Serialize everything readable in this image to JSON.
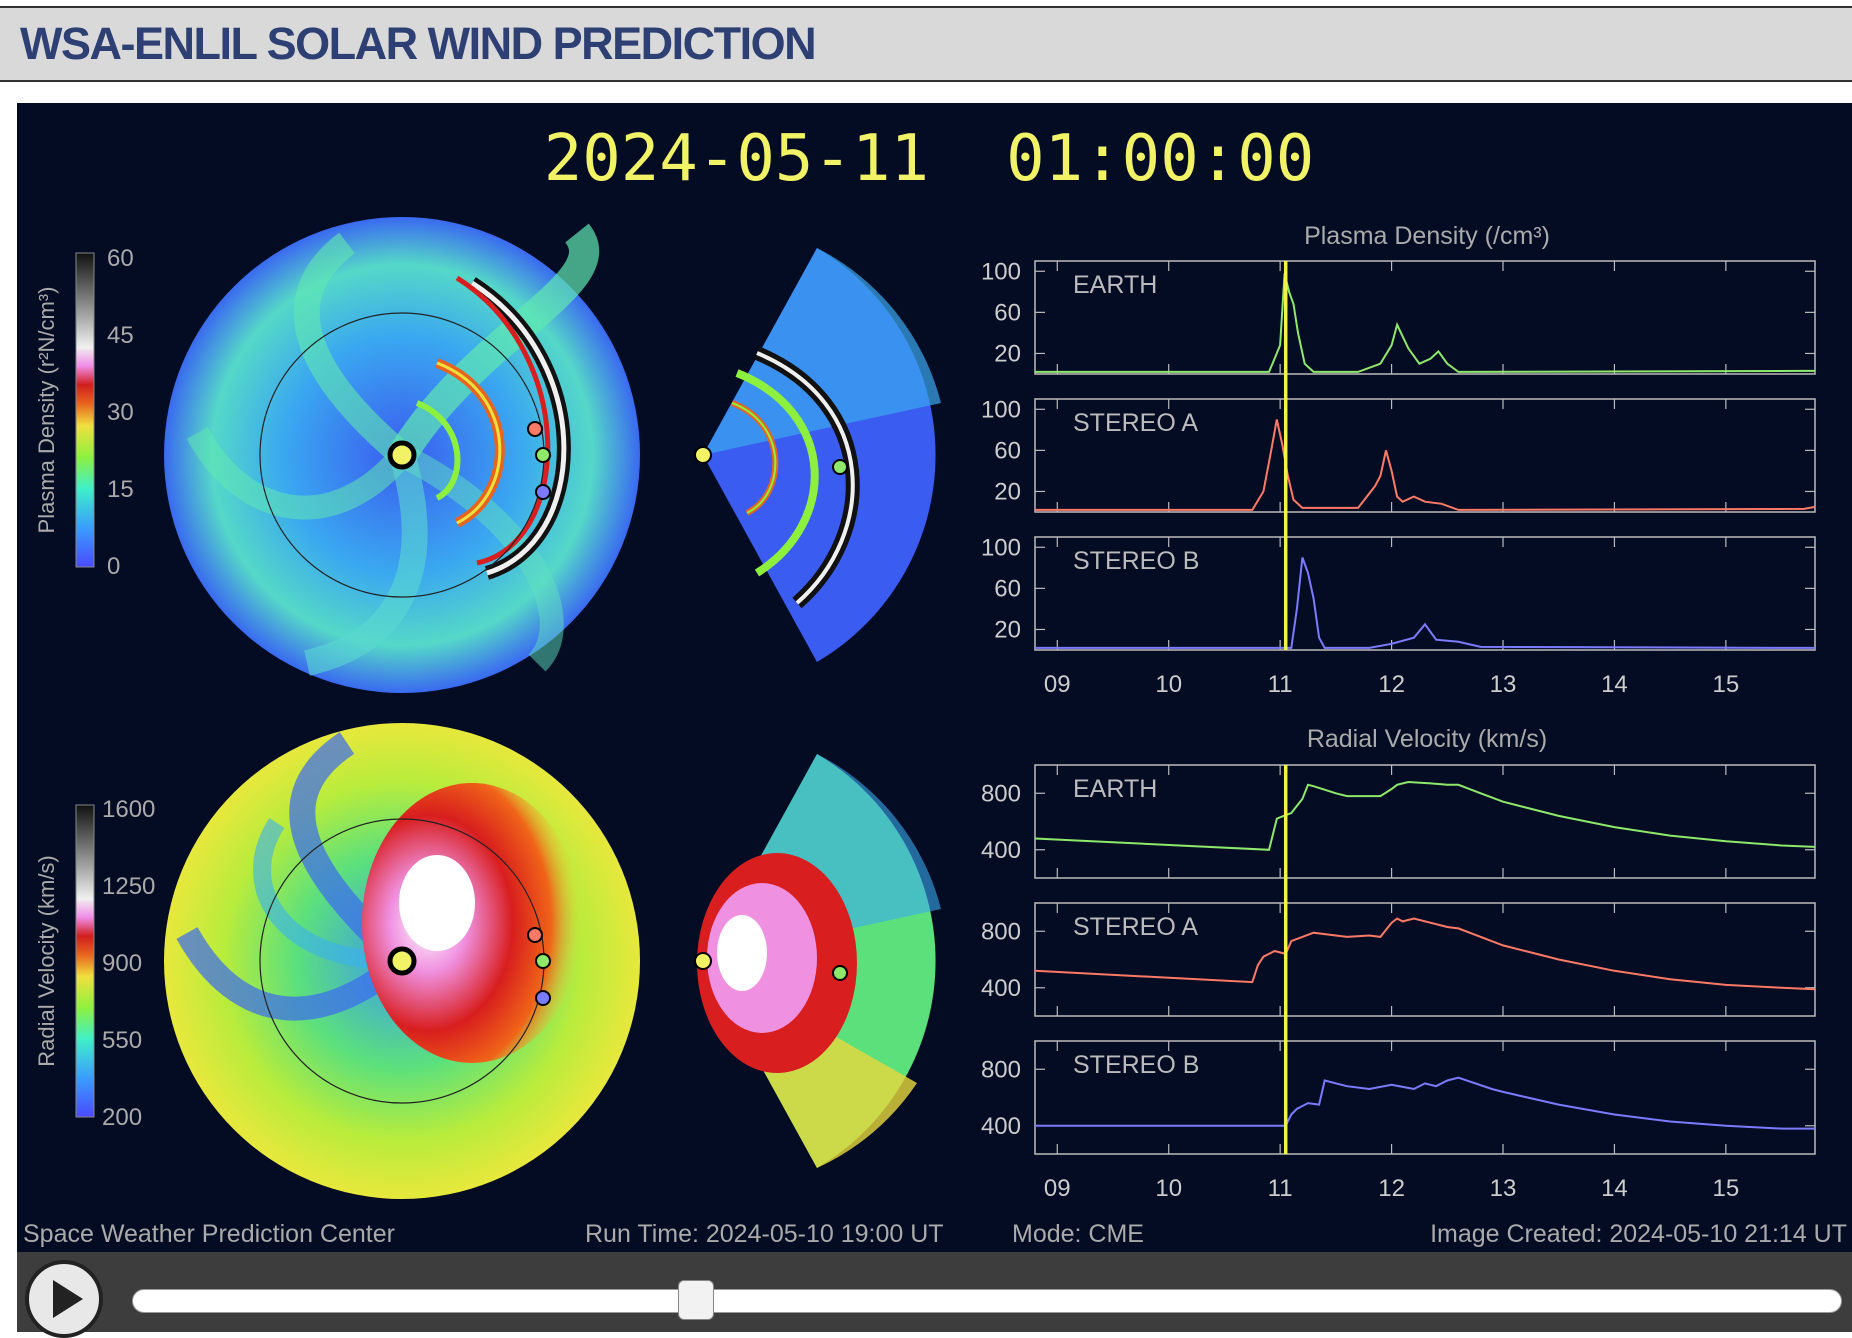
{
  "header": {
    "title": "WSA-ENLIL SOLAR WIND PREDICTION"
  },
  "viz": {
    "timestamp": "2024-05-11  01:00:00",
    "footer": {
      "org": "Space Weather Prediction Center",
      "run_time": "Run Time: 2024-05-10 19:00 UT",
      "mode": "Mode: CME",
      "image_created": "Image Created: 2024-05-10 21:14 UT"
    },
    "density_colorbar": {
      "label": "Plasma Density (r²N/cm³)",
      "ticks": [
        "60",
        "45",
        "30",
        "15",
        "0"
      ]
    },
    "velocity_colorbar": {
      "label": "Radial Velocity (km/s)",
      "ticks": [
        "1600",
        "1250",
        "900",
        "550",
        "200"
      ]
    }
  },
  "player": {
    "position": 0.33
  },
  "colors": {
    "earth": "#8ee86a",
    "stereo_a": "#ff7a66",
    "stereo_b": "#7b7bff",
    "now_line": "#f2f24a",
    "title_yellow": "#f2f266"
  },
  "chart_data": [
    {
      "type": "line",
      "title": "Plasma Density (/cm³)",
      "x_ticks": [
        "09",
        "10",
        "11",
        "12",
        "13",
        "14",
        "15"
      ],
      "xlim": [
        8.8,
        15.8
      ],
      "ylim": [
        0,
        110
      ],
      "y_ticks": [
        "100",
        "60",
        "20"
      ],
      "current_x": 11.05,
      "panels": [
        {
          "name": "EARTH",
          "x": [
            8.8,
            10.9,
            10.95,
            11.0,
            11.04,
            11.08,
            11.12,
            11.16,
            11.22,
            11.3,
            11.7,
            11.9,
            12.0,
            12.05,
            12.15,
            12.25,
            12.35,
            12.42,
            12.5,
            12.6,
            15.7,
            15.8
          ],
          "y": [
            2,
            2,
            15,
            28,
            98,
            80,
            68,
            40,
            10,
            2,
            2,
            10,
            28,
            48,
            25,
            10,
            15,
            22,
            10,
            2,
            3,
            3
          ]
        },
        {
          "name": "STEREO A",
          "x": [
            8.8,
            10.75,
            10.85,
            10.92,
            10.97,
            11.02,
            11.07,
            11.12,
            11.2,
            11.4,
            11.7,
            11.85,
            11.9,
            11.95,
            12.0,
            12.05,
            12.1,
            12.2,
            12.3,
            12.45,
            12.6,
            15.7,
            15.8
          ],
          "y": [
            2,
            2,
            20,
            60,
            90,
            65,
            35,
            12,
            4,
            4,
            4,
            25,
            35,
            60,
            40,
            15,
            10,
            15,
            10,
            8,
            2,
            3,
            5
          ]
        },
        {
          "name": "STEREO B",
          "x": [
            8.8,
            11.1,
            11.15,
            11.2,
            11.25,
            11.3,
            11.35,
            11.4,
            11.8,
            12.0,
            12.2,
            12.3,
            12.4,
            12.6,
            12.8,
            15.7,
            15.8
          ],
          "y": [
            2,
            2,
            40,
            90,
            75,
            50,
            12,
            2,
            2,
            6,
            12,
            25,
            10,
            8,
            3,
            2,
            2
          ]
        }
      ]
    },
    {
      "type": "line",
      "title": "Radial Velocity (km/s)",
      "x_ticks": [
        "09",
        "10",
        "11",
        "12",
        "13",
        "14",
        "15"
      ],
      "xlim": [
        8.8,
        15.8
      ],
      "ylim": [
        200,
        1000
      ],
      "y_ticks": [
        "800",
        "400"
      ],
      "current_x": 11.05,
      "panels": [
        {
          "name": "EARTH",
          "x": [
            8.8,
            10.9,
            10.92,
            10.97,
            11.0,
            11.1,
            11.2,
            11.25,
            11.3,
            11.5,
            11.6,
            11.9,
            12.0,
            12.05,
            12.15,
            12.35,
            12.5,
            12.6,
            12.8,
            13.0,
            13.5,
            14.0,
            14.5,
            15.0,
            15.5,
            15.8
          ],
          "y": [
            480,
            400,
            460,
            620,
            630,
            660,
            760,
            860,
            850,
            800,
            780,
            780,
            830,
            860,
            880,
            870,
            860,
            860,
            800,
            740,
            640,
            560,
            500,
            460,
            430,
            420
          ]
        },
        {
          "name": "STEREO A",
          "x": [
            8.8,
            10.75,
            10.8,
            10.85,
            10.95,
            11.05,
            11.1,
            11.3,
            11.4,
            11.6,
            11.8,
            11.9,
            12.0,
            12.05,
            12.1,
            12.2,
            12.5,
            12.6,
            13.0,
            13.5,
            14.0,
            14.5,
            15.0,
            15.5,
            15.8
          ],
          "y": [
            520,
            440,
            560,
            620,
            660,
            640,
            730,
            790,
            780,
            760,
            770,
            760,
            860,
            890,
            870,
            890,
            830,
            820,
            700,
            600,
            520,
            460,
            420,
            400,
            390
          ]
        },
        {
          "name": "STEREO B",
          "x": [
            8.8,
            11.05,
            11.1,
            11.15,
            11.25,
            11.35,
            11.4,
            11.6,
            11.8,
            12.0,
            12.2,
            12.3,
            12.4,
            12.5,
            12.6,
            12.9,
            13.0,
            13.5,
            14.0,
            14.5,
            15.0,
            15.5,
            15.8
          ],
          "y": [
            400,
            400,
            480,
            520,
            560,
            550,
            720,
            680,
            660,
            690,
            660,
            700,
            680,
            720,
            740,
            660,
            640,
            550,
            480,
            430,
            400,
            380,
            380
          ]
        }
      ]
    }
  ]
}
